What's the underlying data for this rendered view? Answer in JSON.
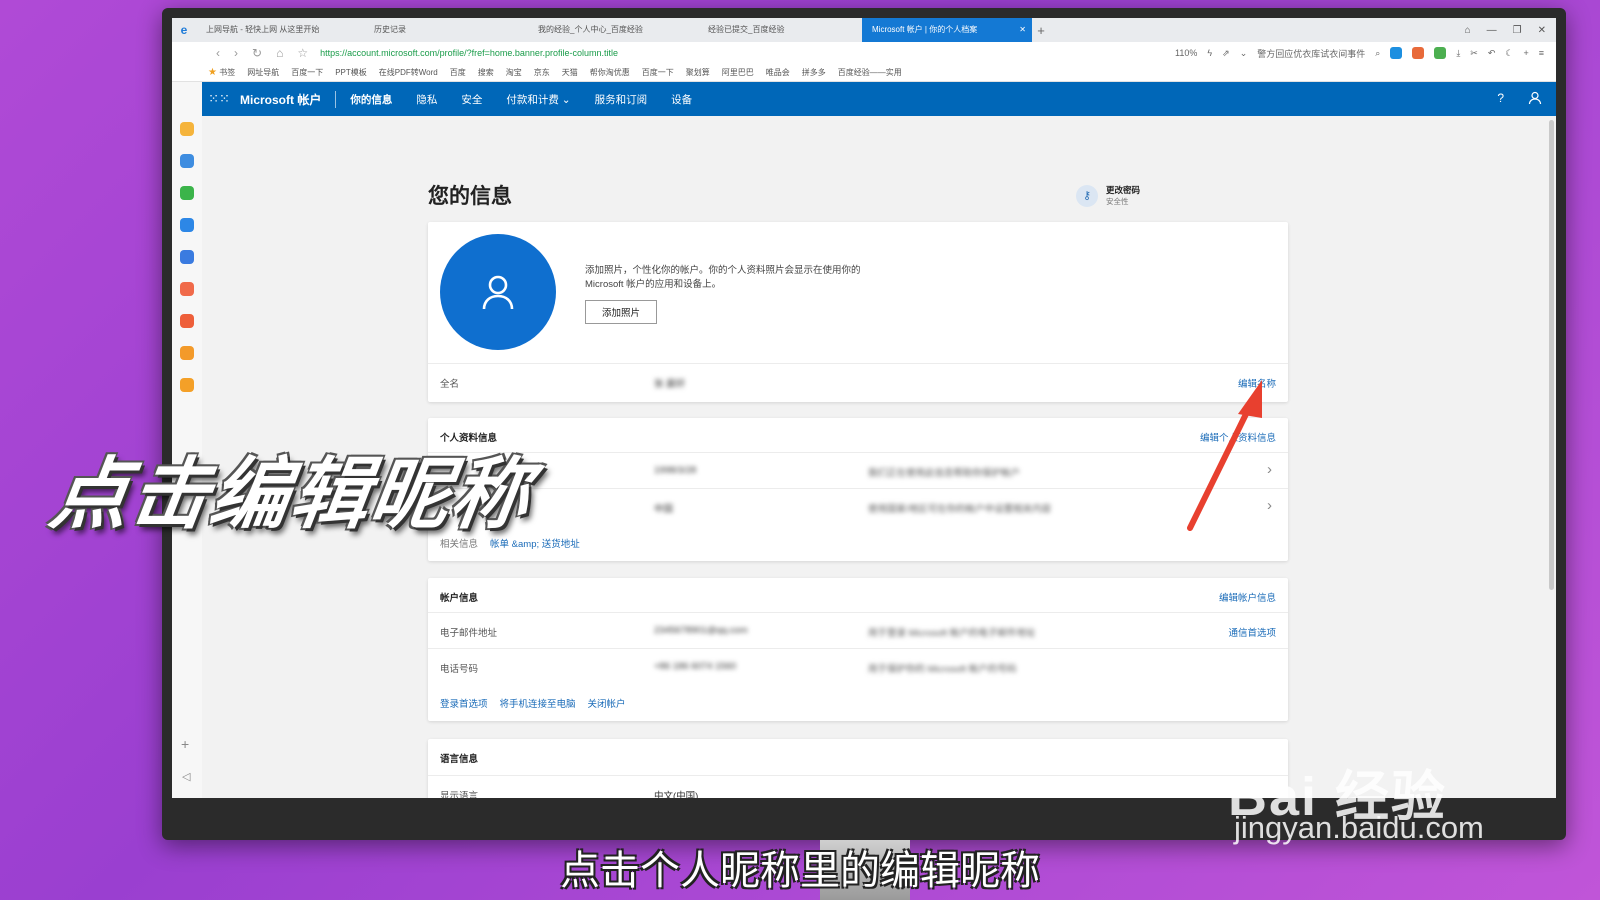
{
  "browser": {
    "tabs": [
      {
        "label": "上网导航 - 轻快上网 从这里开始"
      },
      {
        "label": "历史记录"
      },
      {
        "label": "我的经验_个人中心_百度经验"
      },
      {
        "label": "经验已提交_百度经验"
      },
      {
        "label": "Microsoft 帐户 | 你的个人档案",
        "active": true
      }
    ],
    "url": "https://account.microsoft.com/profile/?fref=home.banner.profile-column.title",
    "zoom": "110%",
    "news_text": "警方回应优衣库试衣间事件",
    "bookmarks_label": "书签",
    "bookmarks": [
      "网址导航",
      "百度一下",
      "PPT模板",
      "在线PDF转Word",
      "百度",
      "搜索",
      "淘宝",
      "京东",
      "天猫",
      "帮你淘优惠",
      "百度一下",
      "聚划算",
      "阿里巴巴",
      "唯品会",
      "拼多多",
      "百度经验——实用"
    ]
  },
  "ms_header": {
    "brand": "Microsoft 帐户",
    "nav": [
      "你的信息",
      "隐私",
      "安全",
      "付款和计费",
      "服务和订阅",
      "设备"
    ],
    "help": "?"
  },
  "page": {
    "title": "您的信息",
    "change_password": {
      "title": "更改密码",
      "subtitle": "安全性"
    },
    "photo_desc": "添加照片，个性化你的帐户。你的个人资料照片会显示在使用你的 Microsoft 帐户的应用和设备上。",
    "add_photo": "添加照片",
    "full_name": {
      "label": "全名",
      "value": "张 晨轩",
      "edit": "编辑名称"
    },
    "profile": {
      "title": "个人资料信息",
      "edit": "编辑个人资料信息",
      "rows": [
        {
          "label": "",
          "value": "1998/3/28",
          "desc": "我们正在使用此信息帮助你保护帐户"
        },
        {
          "label": "",
          "value": "中国",
          "desc": "使用国家/地区可在你的帐户中设置相关内容"
        }
      ],
      "related_label": "相关信息",
      "related_links": [
        "帐单 &amp; 送货地址"
      ]
    },
    "account": {
      "title": "帐户信息",
      "edit": "编辑帐户信息",
      "email_label": "电子邮件地址",
      "email_value": "2345678901@qq.com",
      "email_desc": "用于登录 Microsoft 帐户的电子邮件地址",
      "email_link": "通信首选项",
      "phone_label": "电话号码",
      "phone_value": "+86 186 6074 1560",
      "phone_desc": "用于保护你的 Microsoft 帐户的号码",
      "links": [
        "登录首选项",
        "将手机连接至电脑",
        "关闭帐户"
      ]
    },
    "language": {
      "title": "语言信息",
      "display_label": "显示语言",
      "display_value": "中文(中国)"
    }
  },
  "overlay": {
    "big_caption": "点击编辑昵称",
    "subtitle": "点击个人昵称里的编辑昵称",
    "watermark": "Bai 经验",
    "watermark_url": "jingyan.baidu.com"
  },
  "colors": {
    "brand_blue": "#0067b8",
    "link": "#1a6bb8",
    "arrow": "#e8402f"
  }
}
